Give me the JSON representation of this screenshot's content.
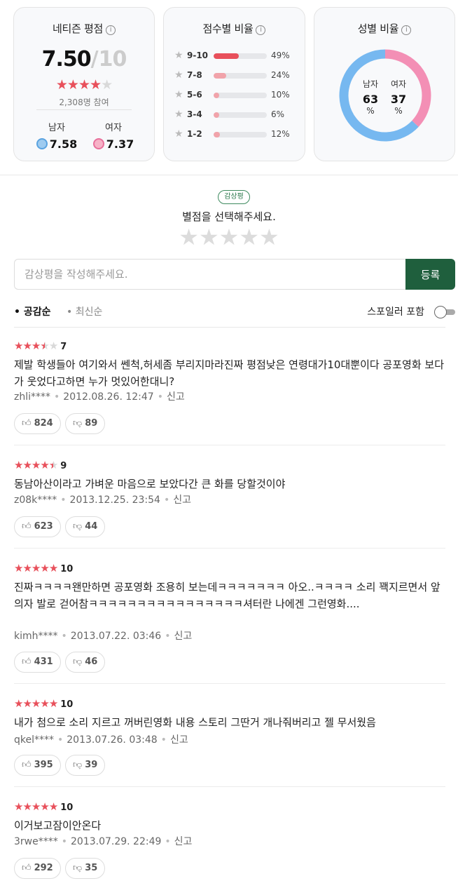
{
  "netizen": {
    "title": "네티즌 평점",
    "info": "i",
    "score": "7.50",
    "separator": "/",
    "max": "10",
    "stars_filled": 4,
    "participants": "2,308명 참여",
    "male_label": "남자",
    "male_score": "7.58",
    "female_label": "여자",
    "female_score": "7.37"
  },
  "distribution": {
    "title": "점수별 비율",
    "info": "i",
    "rows": [
      {
        "label": "9-10",
        "pct": "49%",
        "value": 49,
        "color": "#e8505b"
      },
      {
        "label": "7-8",
        "pct": "24%",
        "value": 24,
        "color": "#f1a3aa"
      },
      {
        "label": "5-6",
        "pct": "10%",
        "value": 10,
        "color": "#f1a3aa"
      },
      {
        "label": "3-4",
        "pct": "6%",
        "value": 6,
        "color": "#f1a3aa"
      },
      {
        "label": "1-2",
        "pct": "12%",
        "value": 12,
        "color": "#f1a3aa"
      }
    ]
  },
  "gender": {
    "title": "성별 비율",
    "info": "i",
    "male_label": "남자",
    "male_pct": "63",
    "female_label": "여자",
    "female_pct": "37",
    "unit": "%",
    "male_color": "#76b8f0",
    "female_color": "#f38fb5"
  },
  "rating_prompt": {
    "badge": "감상평",
    "text": "별점을 선택해주세요."
  },
  "comment_input": {
    "placeholder": "감상평을 작성해주세요.",
    "submit": "등록"
  },
  "sort": {
    "active": "• 공감순",
    "inactive": "• 최신순",
    "spoiler": "스포일러 포함"
  },
  "colors": {
    "accent_red": "#e8505b",
    "brand_green": "#1f5f3d"
  },
  "reviews": [
    {
      "stars": 3.5,
      "score": "7",
      "text": "제발 학생들아 여기와서 쎈척,허세좀 부리지마라진짜 평점낮은 연령대가10대뿐이다 공포영화 보다가 웃었다고하면 누가 멋있어한대니?",
      "user": "zhli****",
      "date": "2012.08.26. 12:47",
      "report": "신고",
      "like": "824",
      "dislike": "89"
    },
    {
      "stars": 4.5,
      "score": "9",
      "text": "동남아산이라고 가벼운 마음으로 보았다간 큰 화를 당할것이야",
      "user": "z08k****",
      "date": "2013.12.25. 23:54",
      "report": "신고",
      "like": "623",
      "dislike": "44"
    },
    {
      "stars": 5,
      "score": "10",
      "text": "진짜ㅋㅋㅋㅋ왠만하면 공포영화 조용히 보는데ㅋㅋㅋㅋㅋㅋㅋ 아오..ㅋㅋㅋㅋ 소리 꽥지르면서 앞 의자 발로 걷어참ㅋㅋㅋㅋㅋㅋㅋㅋㅋㅋㅋㅋㅋㅋㅋㅋ셔터란 나에겐 그런영화....",
      "user": "kimh****",
      "date": "2013.07.22. 03:46",
      "report": "신고",
      "like": "431",
      "dislike": "46"
    },
    {
      "stars": 5,
      "score": "10",
      "text": "내가 첨으로 소리 지르고 꺼버린영화 내용 스토리 그딴거 개나줘버리고 젤 무서웠음",
      "user": "qkel****",
      "date": "2013.07.26. 03:48",
      "report": "신고",
      "like": "395",
      "dislike": "39"
    },
    {
      "stars": 5,
      "score": "10",
      "text": "이거보고잠이안온다",
      "user": "3rwe****",
      "date": "2013.07.29. 22:49",
      "report": "신고",
      "like": "292",
      "dislike": "35"
    }
  ]
}
